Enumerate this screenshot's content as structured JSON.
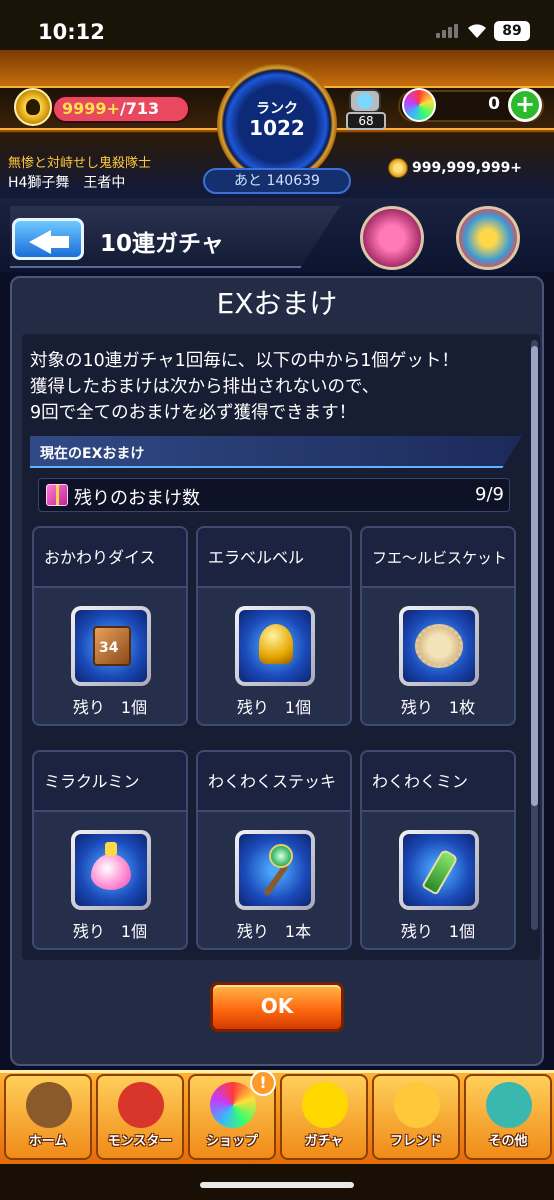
{
  "status_bar": {
    "time": "10:12",
    "battery": "89"
  },
  "hud": {
    "stamina_current": "9999+",
    "stamina_max": "/713",
    "rank_label": "ランク",
    "rank_value": "1022",
    "rank_next": "あと 140639",
    "gem_count": "68",
    "orb_count": "0",
    "plus_label": "+",
    "quest_title": "無惨と対峙せし鬼殺隊士",
    "player_name": "H4獅子舞　王者中",
    "coins": "999,999,999+"
  },
  "header": {
    "title": "10連ガチャ"
  },
  "modal": {
    "title": "EXおまけ",
    "description": [
      "対象の10連ガチャ1回毎に、以下の中から1個ゲット！",
      "獲得したおまけは次から排出されないので、",
      "9回で全てのおまけを必ず獲得できます！"
    ],
    "section_label": "現在のEXおまけ",
    "remaining_label": "残りのおまけ数",
    "remaining_value": "9/9",
    "items": [
      {
        "name": "おかわりダイス",
        "remain": "残り　1個",
        "icon": "dice-icon"
      },
      {
        "name": "エラベルベル",
        "remain": "残り　1個",
        "icon": "bell-icon"
      },
      {
        "name": "フエ〜ルビスケット",
        "remain": "残り　1枚",
        "icon": "biscuit-icon"
      },
      {
        "name": "ミラクルミン",
        "remain": "残り　1個",
        "icon": "heart-potion-icon"
      },
      {
        "name": "わくわくステッキ",
        "remain": "残り　1本",
        "icon": "wand-icon"
      },
      {
        "name": "わくわくミン",
        "remain": "残り　1個",
        "icon": "bottle-icon"
      }
    ],
    "ok_label": "OK"
  },
  "nav": {
    "items": [
      {
        "label": "ホーム",
        "icon": "home-icon",
        "color": "#8a5a2a"
      },
      {
        "label": "モンスター",
        "icon": "monster-icon",
        "color": "#d8362a"
      },
      {
        "label": "ショップ",
        "icon": "shop-orb-icon",
        "color": "#6a4ad8"
      },
      {
        "label": "ガチャ",
        "icon": "gacha-icon",
        "color": "#ffd800"
      },
      {
        "label": "フレンド",
        "icon": "friend-icon",
        "color": "#ffc83a"
      },
      {
        "label": "その他",
        "icon": "other-icon",
        "color": "#3ab8b0"
      }
    ],
    "shop_badge": "!"
  },
  "colors": {
    "accent": "#ff7a1a",
    "panel": "#232b45",
    "highlight": "#ffc83a"
  }
}
